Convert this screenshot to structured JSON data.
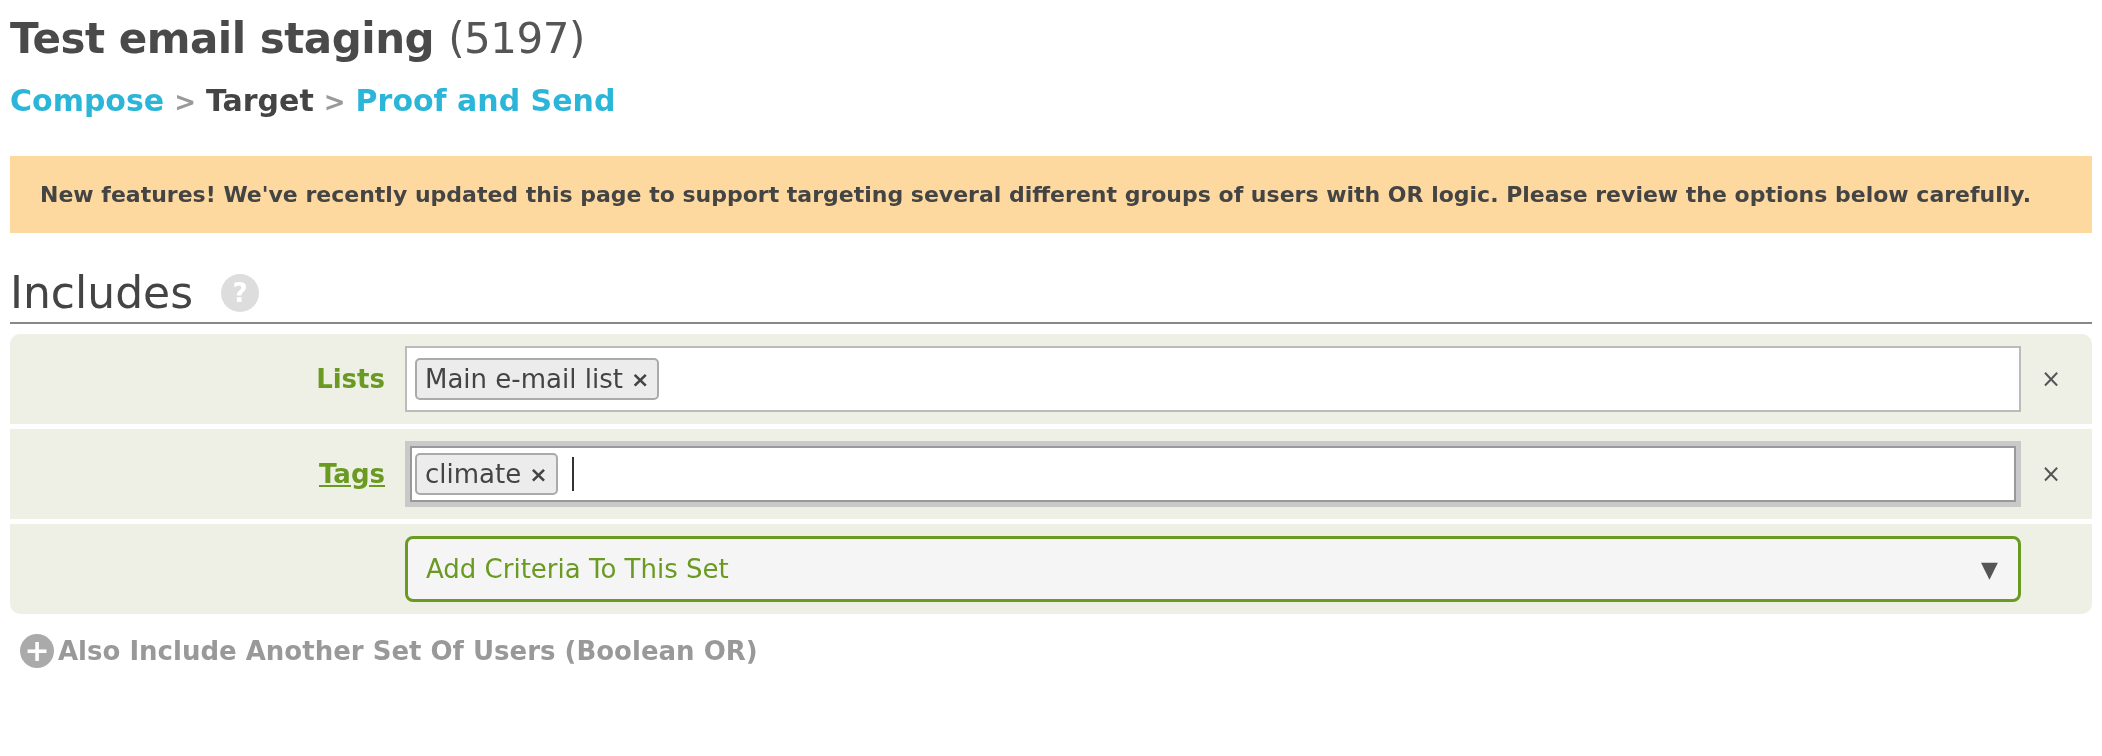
{
  "page_title": {
    "name": "Test email staging",
    "count": "(5197)"
  },
  "breadcrumb": {
    "separator": ">",
    "steps": [
      {
        "label": "Compose",
        "selected": false
      },
      {
        "label": "Target",
        "selected": true
      },
      {
        "label": "Proof and Send",
        "selected": false
      }
    ]
  },
  "notice": "New features! We've recently updated this page to support targeting several different groups of users with OR logic. Please review the options below carefully.",
  "includes": {
    "heading": "Includes",
    "help": "?",
    "rows": [
      {
        "kind": "tokens",
        "label": "Lists",
        "focused": false,
        "tokens": [
          {
            "text": "Main e-mail list",
            "remove": "×"
          }
        ],
        "remove": "×"
      },
      {
        "kind": "tokens",
        "label": "Tags",
        "focused": true,
        "tokens": [
          {
            "text": "climate",
            "remove": "×"
          }
        ],
        "remove": "×"
      },
      {
        "kind": "select",
        "placeholder": "Add Criteria To This Set",
        "caret": "▼"
      }
    ]
  },
  "add_set": {
    "icon": "+",
    "label": "Also Include Another Set Of Users (Boolean OR)"
  }
}
